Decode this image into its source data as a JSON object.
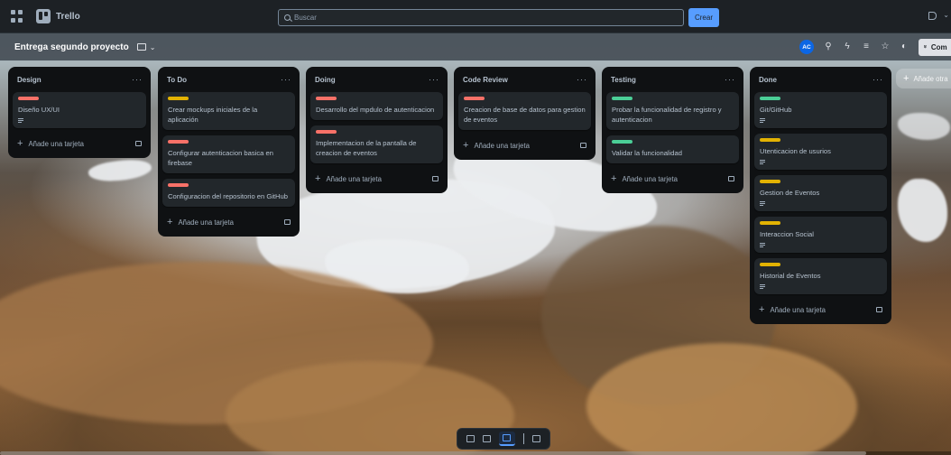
{
  "app": {
    "name": "Trello"
  },
  "search": {
    "placeholder": "Buscar"
  },
  "create_label": "Crear",
  "board": {
    "title": "Entrega segundo proyecto",
    "avatar_initials": "AC",
    "share_label": "Com"
  },
  "colors": {
    "red": "#f87168",
    "yellow": "#e2b203",
    "green": "#4bce97",
    "blue": "#579dff"
  },
  "lists": [
    {
      "title": "Design",
      "cards": [
        {
          "label": "red",
          "title": "Diseño UX/UI",
          "desc": true
        }
      ],
      "add_label": "Añade una tarjeta"
    },
    {
      "title": "To Do",
      "cards": [
        {
          "label": "yellow",
          "title": "Crear mockups iniciales de la aplicación",
          "desc": false
        },
        {
          "label": "red",
          "title": "Configurar autenticacion basica en firebase",
          "desc": false
        },
        {
          "label": "red",
          "title": "Configuracion del repositorio en GitHub",
          "desc": false
        }
      ],
      "add_label": "Añade una tarjeta"
    },
    {
      "title": "Doing",
      "cards": [
        {
          "label": "red",
          "title": "Desarrollo del mpdulo de autenticacion",
          "desc": false
        },
        {
          "label": "red",
          "title": "Implementacion de la pantalla de creacion de eventos",
          "desc": false
        }
      ],
      "add_label": "Añade una tarjeta"
    },
    {
      "title": "Code Review",
      "cards": [
        {
          "label": "red",
          "title": "Creacion de base de datos para gestion de eventos",
          "desc": false
        }
      ],
      "add_label": "Añade una tarjeta"
    },
    {
      "title": "Testing",
      "cards": [
        {
          "label": "green",
          "title": "Probar la funcionalidad de registro y autenticacion",
          "desc": false
        },
        {
          "label": "green",
          "title": "Validar la funcionalidad",
          "desc": false
        }
      ],
      "add_label": "Añade una tarjeta"
    },
    {
      "title": "Done",
      "cards": [
        {
          "label": "green",
          "title": "Git/GitHub",
          "desc": true
        },
        {
          "label": "yellow",
          "title": "Utenticacion de usurios",
          "desc": true
        },
        {
          "label": "yellow",
          "title": "Gestion de Eventos",
          "desc": true
        },
        {
          "label": "yellow",
          "title": "Interaccion Social",
          "desc": true
        },
        {
          "label": "yellow",
          "title": "Historial de Eventos",
          "desc": true
        }
      ],
      "add_label": "Añade una tarjeta"
    }
  ],
  "add_list_label": "Añade otra"
}
